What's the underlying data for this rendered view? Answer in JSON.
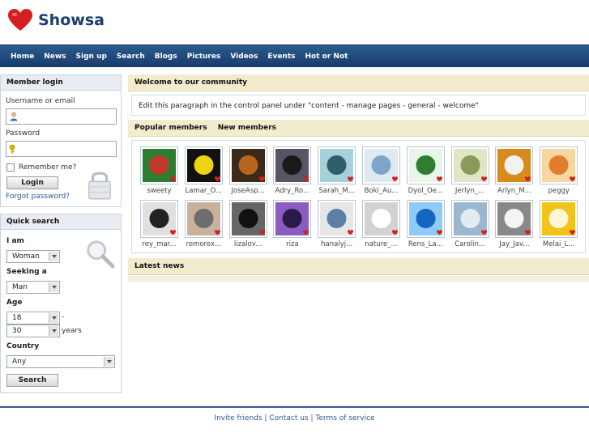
{
  "brand": {
    "name": "Showsa"
  },
  "nav": [
    "Home",
    "News",
    "Sign up",
    "Search",
    "Blogs",
    "Pictures",
    "Videos",
    "Events",
    "Hot or Not"
  ],
  "member_login": {
    "title": "Member login",
    "username_label": "Username or email",
    "password_label": "Password",
    "remember_label": "Remember me?",
    "login_button": "Login",
    "forgot_link": "Forgot password?"
  },
  "quick_search": {
    "title": "Quick search",
    "i_am_label": "I am",
    "i_am_value": "Woman",
    "seeking_label": "Seeking a",
    "seeking_value": "Man",
    "age_label": "Age",
    "age_from": "18",
    "age_dash": "-",
    "age_to": "30",
    "age_unit": "years",
    "country_label": "Country",
    "country_value": "Any",
    "search_button": "Search"
  },
  "welcome": {
    "title": "Welcome to our community",
    "text": "Edit this paragraph in the control panel under \"content - manage pages - general - welcome\""
  },
  "members": {
    "tab_popular": "Popular members",
    "tab_new": "New members",
    "row1": [
      "sweety",
      "Lamar_O...",
      "JoseAsp...",
      "Adry_Ro...",
      "Sarah_M...",
      "Boki_Au...",
      "Dyol_Oe...",
      "Jerlyn_...",
      "Arlyn_M...",
      "peggy"
    ],
    "row2": [
      "rey_mar...",
      "remorex...",
      "lizalov...",
      "riza",
      "hanalyj...",
      "nature_...",
      "Rens_La...",
      "Carolin...",
      "Jay_Jav...",
      "Melai_L..."
    ]
  },
  "latest_news": {
    "title": "Latest news"
  },
  "footer": {
    "invite": "Invite friends",
    "sep": "|",
    "contact": "Contact us",
    "terms": "Terms of service"
  },
  "colors": {
    "nav": "#1f4a7c",
    "brand": "#1b3f6e",
    "section": "#f3ebcd",
    "heart": "#d42020"
  }
}
